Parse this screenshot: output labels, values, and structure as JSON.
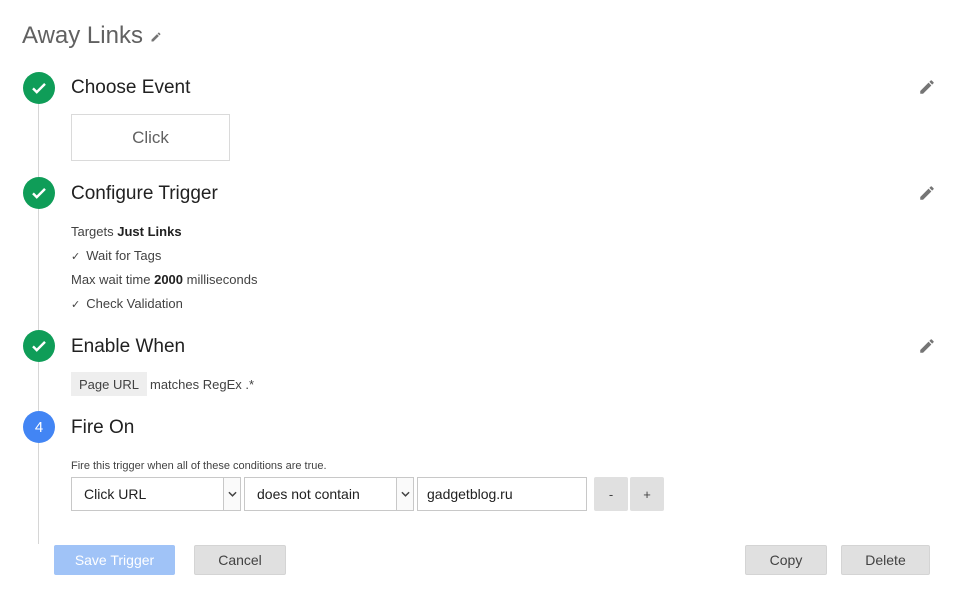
{
  "page": {
    "title": "Away Links",
    "title_edit_icon": "pencil-icon"
  },
  "steps": [
    {
      "title": "Choose Event",
      "status": "done",
      "edit_icon": "pencil-icon"
    },
    {
      "title": "Configure Trigger",
      "status": "done",
      "edit_icon": "pencil-icon"
    },
    {
      "title": "Enable When",
      "status": "done",
      "edit_icon": "pencil-icon"
    },
    {
      "title": "Fire On",
      "status": "active",
      "number": "4"
    }
  ],
  "choose_event": {
    "event": "Click"
  },
  "configure_trigger": {
    "targets_label": "Targets",
    "targets_value": "Just Links",
    "wait_for_tags": "Wait for Tags",
    "max_wait_label": "Max wait time",
    "max_wait_value": "2000",
    "max_wait_unit": "milliseconds",
    "check_validation": "Check Validation"
  },
  "enable_when": {
    "variable": "Page URL",
    "condition": "matches RegEx .*"
  },
  "fire_on": {
    "hint": "Fire this trigger when all of these conditions are true.",
    "variable": "Click URL",
    "operator": "does not contain",
    "value": "gadgetblog.ru",
    "remove_label": "-",
    "add_label": "+"
  },
  "actions": {
    "save": "Save Trigger",
    "cancel": "Cancel",
    "copy": "Copy",
    "delete": "Delete"
  },
  "colors": {
    "done": "#0f9d58",
    "active": "#4285f4",
    "save_disabled": "#a0c3f7"
  }
}
